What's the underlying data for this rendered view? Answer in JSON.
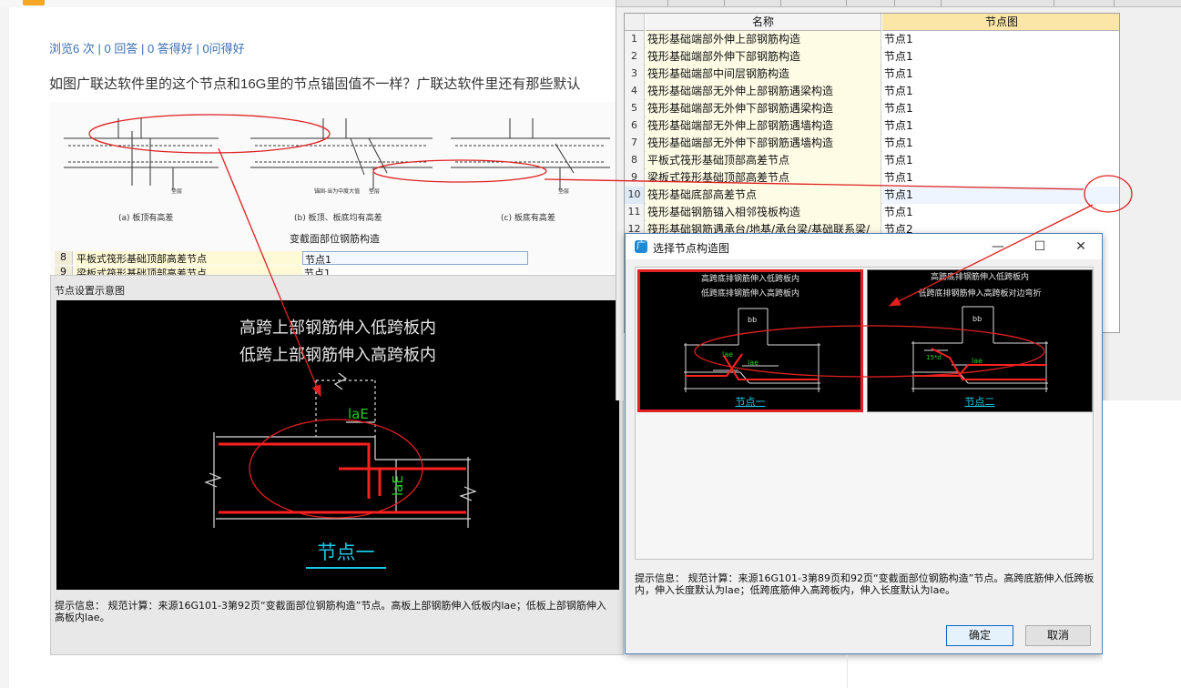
{
  "question": {
    "stats": {
      "views": "浏览6 次",
      "answers": "0 回答",
      "good_answers": "0 答得好",
      "asked_good": "0问得好",
      "separator": "|"
    },
    "text": "如图广联达软件里的这个节点和16G里的节点锚固值不一样？广联达软件里还有那些默认",
    "scan": {
      "sub_captions": [
        "(a) 板顶有高差",
        "(b) 板顶、板底均有高差",
        "(c) 板底有高差"
      ],
      "labels": [
        "垫层",
        "垫层",
        "垫层",
        "锚固-当为中度大值"
      ],
      "caption": "变截面部位钢筋构造"
    },
    "mini_rows": [
      {
        "num": "8",
        "name": "平板式筏形基础顶部高差节点",
        "value": "节点1"
      },
      {
        "num": "9",
        "name": "梁板式筏形基础顶部高差节点",
        "value": "节点1"
      }
    ]
  },
  "node_panel": {
    "title": "节点设置示意图",
    "diagram_line1": "高跨上部钢筋伸入低跨板内",
    "diagram_line2": "低跨上部钢筋伸入高跨板内",
    "label_laE_h": "laE",
    "label_laE_v": "laE",
    "node_label": "节点一",
    "hint": "提示信息： 规范计算：来源16G101-3第92页“变截面部位钢筋构造”节点。高板上部钢筋伸入低板内lae；低板上部钢筋伸入高板内lae。"
  },
  "grid": {
    "headers": {
      "num": "",
      "name": "名称",
      "value": "节点图"
    },
    "rows": [
      {
        "num": "1",
        "name": "筏形基础端部外伸上部钢筋构造",
        "value": "节点1"
      },
      {
        "num": "2",
        "name": "筏形基础端部外伸下部钢筋构造",
        "value": "节点1"
      },
      {
        "num": "3",
        "name": "筏形基础端部中间层钢筋构造",
        "value": "节点1"
      },
      {
        "num": "4",
        "name": "筏形基础端部无外伸上部钢筋遇梁构造",
        "value": "节点1"
      },
      {
        "num": "5",
        "name": "筏形基础端部无外伸下部钢筋遇梁构造",
        "value": "节点1"
      },
      {
        "num": "6",
        "name": "筏形基础端部无外伸上部钢筋遇墙构造",
        "value": "节点1"
      },
      {
        "num": "7",
        "name": "筏形基础端部无外伸下部钢筋遇墙构造",
        "value": "节点1"
      },
      {
        "num": "8",
        "name": "平板式筏形基础顶部高差节点",
        "value": "节点1"
      },
      {
        "num": "9",
        "name": "梁板式筏形基础顶部高差节点",
        "value": "节点1"
      },
      {
        "num": "10",
        "name": "筏形基础底部高差节点",
        "value": "节点1"
      },
      {
        "num": "11",
        "name": "筏形基础钢筋锚入相邻筏板构造",
        "value": "节点1"
      },
      {
        "num": "12",
        "name": "筏形基础钢筋遇承台/地基/承台梁/基础联系梁/",
        "value": "节点2"
      }
    ],
    "ellipsis": "···"
  },
  "dialog": {
    "icon": "广",
    "title": "选择节点构造图",
    "controls": {
      "minimize": "—",
      "maximize": "☐",
      "close": "✕"
    },
    "thumb1": {
      "line1": "高跨底排钢筋伸入低跨板内",
      "line2": "低跨底排钢筋伸入高跨板内",
      "bb": "bb",
      "lae1": "lae",
      "lae2": "lae",
      "label": "节点一"
    },
    "thumb2": {
      "line1": "高跨底排钢筋伸入低跨板内",
      "line2": "低跨底排钢筋伸入高跨板对边弯折",
      "bb": "bb",
      "d": "15*d",
      "lae": "lae",
      "label": "节点二"
    },
    "hint": "提示信息： 规范计算：来源16G101-3第89页和92页“变截面部位钢筋构造”节点。高跨底筋伸入低跨板内，伸入长度默认为lae；低跨底筋伸入高跨板内，伸入长度默认为lae。",
    "ok": "确定",
    "cancel": "取消"
  },
  "colors": {
    "link": "#3a6fb5",
    "annotation_red": "#e02020",
    "cad_bg": "#000000",
    "cad_rebar_red": "#ff2020",
    "cad_text_green": "#22cc22",
    "cad_label_cyan": "#19c8e6",
    "header_yellow": "#fbe6a8",
    "ok_border": "#0a64c8"
  }
}
